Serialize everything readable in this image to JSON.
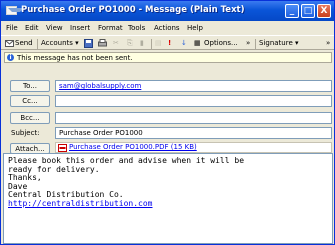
{
  "window": {
    "title": "Purchase Order PO1000 - Message (Plain Text)",
    "minimize": "_",
    "maximize": "□",
    "close": "X"
  },
  "menu": [
    "File",
    "Edit",
    "View",
    "Insert",
    "Format",
    "Tools",
    "Actions",
    "Help"
  ],
  "toolbar": {
    "send": "Send",
    "accounts": "Accounts ▾",
    "options": "Options...",
    "more": "»",
    "signature": "Signature ▾",
    "more2": "»"
  },
  "infobar": {
    "message": "This message has not been sent."
  },
  "header": {
    "to_label": "To...",
    "to_value": "sam@globalsupply.com",
    "cc_label": "Cc...",
    "cc_value": "",
    "bcc_label": "Bcc...",
    "bcc_value": "",
    "subject_label": "Subject:",
    "subject_value": "Purchase Order PO1000",
    "attach_label": "Attach...",
    "attach_value": "Purchase Order PO1000.PDF (15 KB)"
  },
  "body": {
    "line1": "Please book this order and advise when it will be",
    "line2": "ready for delivery.",
    "line3": "",
    "line4": "Thanks,",
    "line5": "Dave",
    "line6": "Central Distribution Co.",
    "line7": "http://centraldistribution.com"
  }
}
